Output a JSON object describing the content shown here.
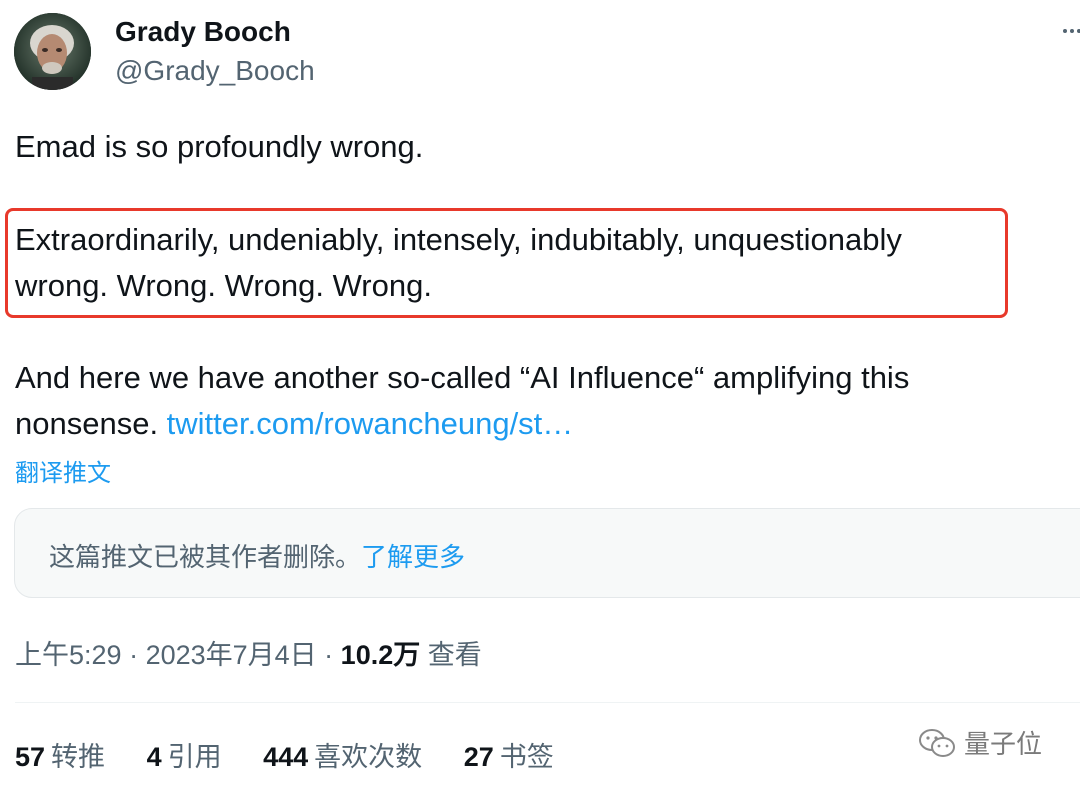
{
  "author": {
    "name": "Grady Booch",
    "handle": "@Grady_Booch"
  },
  "tweet": {
    "line1": "Emad is so profoundly wrong.",
    "line2": "Extraordinarily, undeniably, intensely, indubitably, unquestionably",
    "line3": "wrong. Wrong. Wrong. Wrong.",
    "line4": "And here we have another so-called “AI Influence“ amplifying this",
    "line5_prefix": "nonsense. ",
    "link_text": "twitter.com/rowancheung/st…"
  },
  "translate_label": "翻译推文",
  "quote": {
    "text": "这篇推文已被其作者删除。",
    "learn_more": "了解更多"
  },
  "meta": {
    "time": "上午5:29",
    "sep1": " · ",
    "date": "2023年7月4日",
    "sep2": " · ",
    "views_count": "10.2万",
    "views_label": " 查看"
  },
  "stats": [
    {
      "num": "57",
      "label": "转推"
    },
    {
      "num": "4",
      "label": "引用"
    },
    {
      "num": "444",
      "label": "喜欢次数"
    },
    {
      "num": "27",
      "label": "书签"
    }
  ],
  "watermark": "量子位",
  "colors": {
    "link": "#1d9bf0",
    "highlight_border": "#e8392b",
    "secondary_text": "#536471"
  },
  "icons": {
    "more": "more-horizontal-icon",
    "watermark": "wechat-icon"
  }
}
